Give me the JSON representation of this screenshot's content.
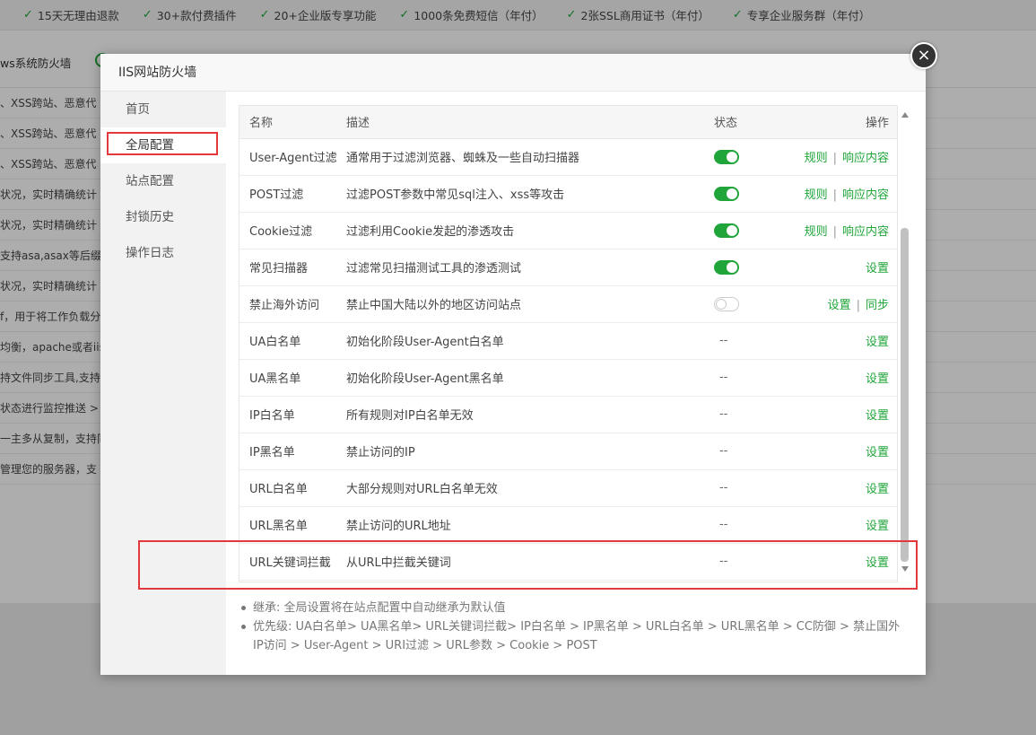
{
  "topbar": {
    "features": [
      "15天无理由退款",
      "30+款付费插件",
      "20+企业版专享功能",
      "1000条免费短信（年付）",
      "2张SSL商用证书（年付）",
      "专享企业服务群（年付）"
    ]
  },
  "bg_header": {
    "title": "ws系统防火墙"
  },
  "bg_rows": [
    "、XSS跨站、恶意代",
    "、XSS跨站、恶意代",
    "、XSS跨站、恶意代",
    "状况，实时精确统计",
    "状况，实时精确统计",
    "支持asa,asax等后缀)",
    "状况，实时精确统计",
    "f，用于将工作负载分",
    "均衡，apache或者iis",
    "持文件同步工具,支持同",
    "状态进行监控推送 >",
    "一主多从复制，支持同",
    "管理您的服务器，支"
  ],
  "modal": {
    "title": "IIS网站防火墙",
    "close_label": "×"
  },
  "sidebar": {
    "items": [
      {
        "label": "首页"
      },
      {
        "label": "全局配置"
      },
      {
        "label": "站点配置"
      },
      {
        "label": "封锁历史"
      },
      {
        "label": "操作日志"
      }
    ]
  },
  "table": {
    "headers": {
      "name": "名称",
      "desc": "描述",
      "state": "状态",
      "op": "操作"
    },
    "rows": [
      {
        "name": "User-Agent过滤",
        "desc": "通常用于过滤浏览器、蜘蛛及一些自动扫描器",
        "state": "on",
        "ops": [
          "规则",
          "响应内容"
        ]
      },
      {
        "name": "POST过滤",
        "desc": "过滤POST参数中常见sql注入、xss等攻击",
        "state": "on",
        "ops": [
          "规则",
          "响应内容"
        ]
      },
      {
        "name": "Cookie过滤",
        "desc": "过滤利用Cookie发起的渗透攻击",
        "state": "on",
        "ops": [
          "规则",
          "响应内容"
        ]
      },
      {
        "name": "常见扫描器",
        "desc": "过滤常见扫描测试工具的渗透测试",
        "state": "on",
        "ops": [
          "设置"
        ]
      },
      {
        "name": "禁止海外访问",
        "desc": "禁止中国大陆以外的地区访问站点",
        "state": "off",
        "ops": [
          "设置",
          "同步"
        ]
      },
      {
        "name": "UA白名单",
        "desc": "初始化阶段User-Agent白名单",
        "state": "--",
        "ops": [
          "设置"
        ]
      },
      {
        "name": "UA黑名单",
        "desc": "初始化阶段User-Agent黑名单",
        "state": "--",
        "ops": [
          "设置"
        ]
      },
      {
        "name": "IP白名单",
        "desc": "所有规则对IP白名单无效",
        "state": "--",
        "ops": [
          "设置"
        ]
      },
      {
        "name": "IP黑名单",
        "desc": "禁止访问的IP",
        "state": "--",
        "ops": [
          "设置"
        ]
      },
      {
        "name": "URL白名单",
        "desc": "大部分规则对URL白名单无效",
        "state": "--",
        "ops": [
          "设置"
        ]
      },
      {
        "name": "URL黑名单",
        "desc": "禁止访问的URL地址",
        "state": "--",
        "ops": [
          "设置"
        ]
      },
      {
        "name": "URL关键词拦截",
        "desc": "从URL中拦截关键词",
        "state": "--",
        "ops": [
          "设置"
        ]
      }
    ]
  },
  "notes": [
    "继承: 全局设置将在站点配置中自动继承为默认值",
    "优先级: UA白名单> UA黑名单> URL关键词拦截> IP白名单 > IP黑名单 > URL白名单 > URL黑名单 > CC防御 > 禁止国外IP访问 > User-Agent > URI过滤 > URL参数 > Cookie > POST"
  ],
  "colors": {
    "accent": "#20a53a",
    "highlight_border": "#e4393c"
  }
}
